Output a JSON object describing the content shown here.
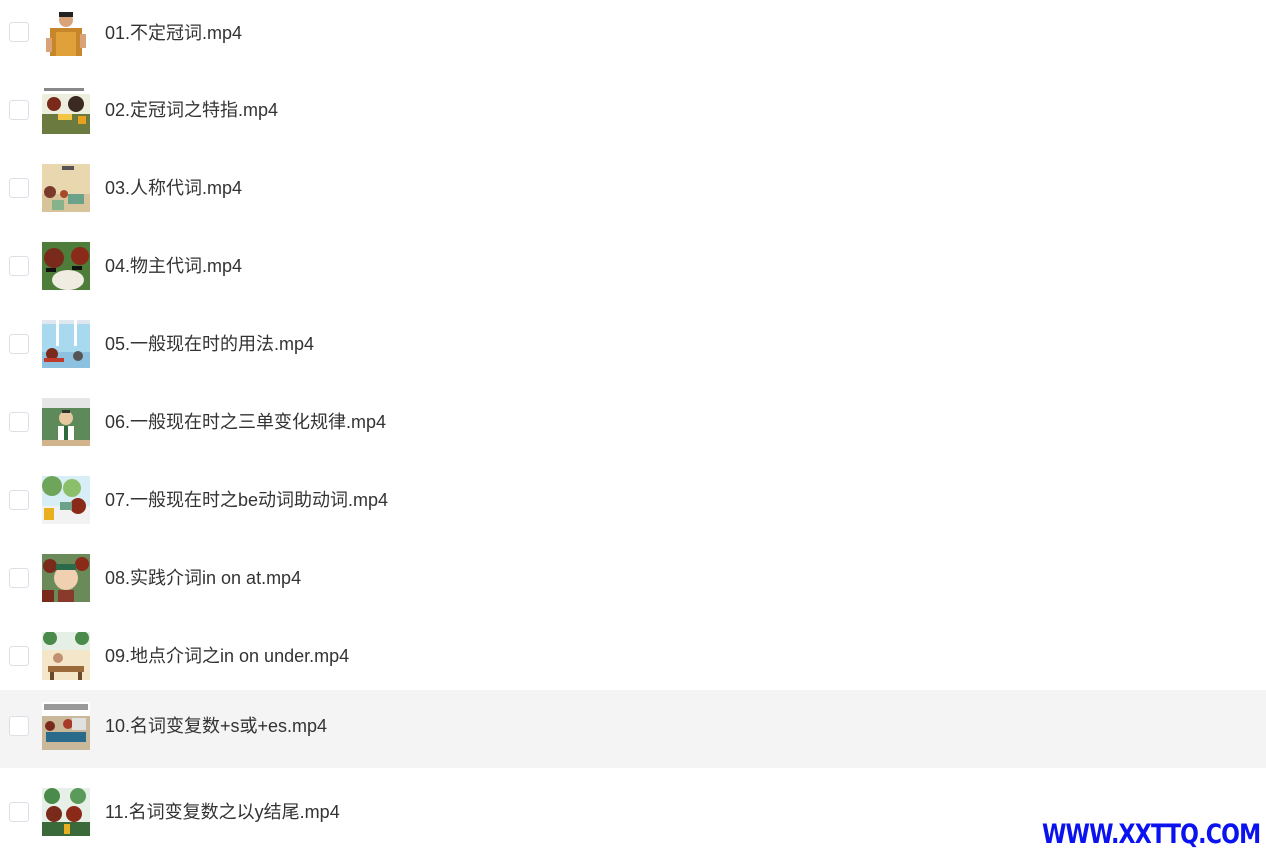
{
  "files": [
    {
      "name": "01.不定冠词.mp4",
      "thumbnail_icon": "video-thumbnail-icon"
    },
    {
      "name": "02.定冠词之特指.mp4",
      "thumbnail_icon": "video-thumbnail-icon"
    },
    {
      "name": "03.人称代词.mp4",
      "thumbnail_icon": "video-thumbnail-icon"
    },
    {
      "name": "04.物主代词.mp4",
      "thumbnail_icon": "video-thumbnail-icon"
    },
    {
      "name": "05.一般现在时的用法.mp4",
      "thumbnail_icon": "video-thumbnail-icon"
    },
    {
      "name": "06.一般现在时之三单变化规律.mp4",
      "thumbnail_icon": "video-thumbnail-icon"
    },
    {
      "name": "07.一般现在时之be动词助动词.mp4",
      "thumbnail_icon": "video-thumbnail-icon"
    },
    {
      "name": "08.实践介词in on at.mp4",
      "thumbnail_icon": "video-thumbnail-icon"
    },
    {
      "name": "09.地点介词之in on under.mp4",
      "thumbnail_icon": "video-thumbnail-icon"
    },
    {
      "name": "10.名词变复数+s或+es.mp4",
      "thumbnail_icon": "video-thumbnail-icon",
      "highlighted": true
    },
    {
      "name": "11.名词变复数之以y结尾.mp4",
      "thumbnail_icon": "video-thumbnail-icon"
    }
  ],
  "watermark": "WWW.XXTTQ.COM",
  "colors": {
    "row_highlight": "#f4f4f5",
    "text": "#333333",
    "checkbox_border": "#dcdfe6",
    "watermark": "#0a12ef"
  }
}
